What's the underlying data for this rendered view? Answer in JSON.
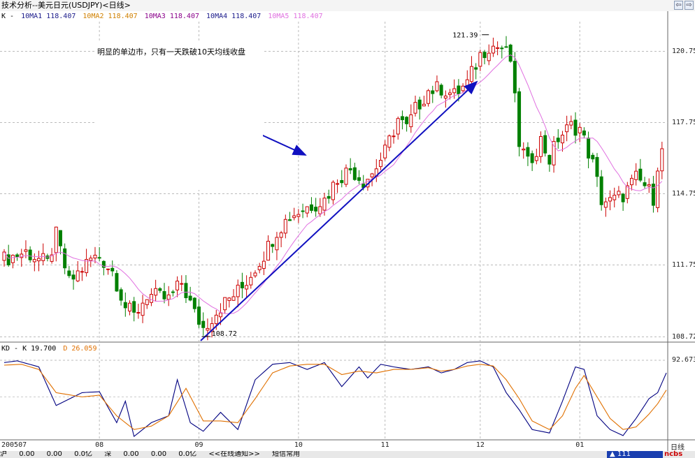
{
  "window": {
    "title": "技术分析--美元日元(USDJPY)<日线>",
    "buttons": [
      "⇦",
      "⇨"
    ]
  },
  "ma_legend": [
    {
      "text": "K -",
      "color": "#000000"
    },
    {
      "text": "10MA1  118.407",
      "color": "#1a1a8a"
    },
    {
      "text": "10MA2  118.407",
      "color": "#d08000"
    },
    {
      "text": "10MA3  118.407",
      "color": "#8a008a"
    },
    {
      "text": "10MA4  118.407",
      "color": "#1a1a8a"
    },
    {
      "text": "10MA5  118.407",
      "color": "#e070e0"
    }
  ],
  "annotation": "明显的单边市，只有一天跌破10天均线收盘",
  "kd_legend": [
    {
      "text": "KD - K 19.700",
      "color": "#000000"
    },
    {
      "text": "D 26.059",
      "color": "#e07000"
    }
  ],
  "status_bar": {
    "items": [
      "沪",
      "0.00",
      "0.00",
      "0.0亿",
      "深",
      "0.00",
      "0.00",
      "0.0亿",
      "<<在线通知>>",
      "短信常用"
    ],
    "badge": "▲ 111",
    "logo": "ncbs"
  },
  "chart_data": [
    {
      "type": "candlestick",
      "title": "",
      "ylim": [
        108.5,
        122.0
      ],
      "y_ticks": [
        "120.75",
        "117.75",
        "114.75",
        "111.75",
        "108.72"
      ],
      "y_tick_values": [
        120.75,
        117.75,
        114.75,
        111.75,
        108.72
      ],
      "x_ticks": [
        "200507",
        "08",
        "09",
        "10",
        "11",
        "12",
        "01"
      ],
      "x_tick_index": [
        0,
        22,
        45,
        68,
        88,
        110,
        133
      ],
      "x_axis_right_label": "日线",
      "n_periods": 153,
      "annotations": {
        "high": "121.39",
        "low": "108.72",
        "high_index": 112,
        "low_index": 46
      },
      "up_color": "#cc0000",
      "down_color": "#008000",
      "ma_color": "#e070e0",
      "anchors": [
        [
          0,
          112.0
        ],
        [
          5,
          112.3
        ],
        [
          10,
          111.8
        ],
        [
          12,
          113.0
        ],
        [
          15,
          111.0
        ],
        [
          20,
          112.0
        ],
        [
          22,
          112.1
        ],
        [
          25,
          111.5
        ],
        [
          28,
          110.0
        ],
        [
          30,
          109.6
        ],
        [
          33,
          110.5
        ],
        [
          38,
          110.3
        ],
        [
          41,
          111.0
        ],
        [
          44,
          109.7
        ],
        [
          46,
          109.1
        ],
        [
          50,
          110.0
        ],
        [
          55,
          110.8
        ],
        [
          60,
          112.2
        ],
        [
          63,
          113.2
        ],
        [
          66,
          113.8
        ],
        [
          70,
          114.2
        ],
        [
          74,
          114.5
        ],
        [
          77,
          115.4
        ],
        [
          80,
          115.8
        ],
        [
          83,
          115.3
        ],
        [
          85,
          115.6
        ],
        [
          88,
          116.5
        ],
        [
          91,
          117.9
        ],
        [
          93,
          117.5
        ],
        [
          95,
          118.3
        ],
        [
          98,
          119.1
        ],
        [
          101,
          119.2
        ],
        [
          104,
          118.9
        ],
        [
          107,
          119.4
        ],
        [
          110,
          120.6
        ],
        [
          112,
          121.0
        ],
        [
          115,
          120.9
        ],
        [
          117,
          120.4
        ],
        [
          119,
          116.9
        ],
        [
          121,
          116.0
        ],
        [
          124,
          117.0
        ],
        [
          126,
          116.2
        ],
        [
          128,
          117.1
        ],
        [
          131,
          117.6
        ],
        [
          133,
          117.5
        ],
        [
          136,
          116.0
        ],
        [
          138,
          114.5
        ],
        [
          140,
          114.4
        ],
        [
          143,
          114.7
        ],
        [
          146,
          115.4
        ],
        [
          148,
          115.1
        ],
        [
          150,
          114.6
        ],
        [
          151,
          116.0
        ],
        [
          153,
          117.0
        ]
      ]
    },
    {
      "type": "line",
      "title": "KD",
      "ylim": [
        0,
        100
      ],
      "y_ticks": [
        "92.673"
      ],
      "y_tick_values": [
        92.673
      ],
      "series": [
        {
          "name": "K",
          "color": "#000080",
          "anchors": [
            [
              0,
              90
            ],
            [
              3,
              92
            ],
            [
              8,
              85
            ],
            [
              12,
              40
            ],
            [
              18,
              55
            ],
            [
              22,
              56
            ],
            [
              26,
              20
            ],
            [
              28,
              45
            ],
            [
              30,
              4
            ],
            [
              34,
              20
            ],
            [
              38,
              28
            ],
            [
              40,
              70
            ],
            [
              43,
              20
            ],
            [
              46,
              10
            ],
            [
              50,
              32
            ],
            [
              54,
              12
            ],
            [
              58,
              70
            ],
            [
              62,
              88
            ],
            [
              66,
              90
            ],
            [
              70,
              82
            ],
            [
              74,
              90
            ],
            [
              78,
              62
            ],
            [
              82,
              85
            ],
            [
              84,
              72
            ],
            [
              87,
              88
            ],
            [
              90,
              85
            ],
            [
              94,
              82
            ],
            [
              98,
              85
            ],
            [
              101,
              78
            ],
            [
              104,
              82
            ],
            [
              107,
              90
            ],
            [
              110,
              92
            ],
            [
              113,
              85
            ],
            [
              116,
              55
            ],
            [
              119,
              35
            ],
            [
              122,
              12
            ],
            [
              126,
              8
            ],
            [
              129,
              45
            ],
            [
              132,
              85
            ],
            [
              134,
              82
            ],
            [
              137,
              28
            ],
            [
              140,
              12
            ],
            [
              143,
              5
            ],
            [
              146,
              25
            ],
            [
              149,
              48
            ],
            [
              151,
              55
            ],
            [
              153,
              78
            ]
          ]
        },
        {
          "name": "D",
          "color": "#e07000",
          "anchors": [
            [
              0,
              87
            ],
            [
              4,
              88
            ],
            [
              8,
              82
            ],
            [
              12,
              55
            ],
            [
              18,
              50
            ],
            [
              22,
              52
            ],
            [
              26,
              28
            ],
            [
              30,
              12
            ],
            [
              34,
              16
            ],
            [
              38,
              28
            ],
            [
              42,
              60
            ],
            [
              46,
              22
            ],
            [
              50,
              22
            ],
            [
              54,
              20
            ],
            [
              58,
              48
            ],
            [
              62,
              78
            ],
            [
              66,
              86
            ],
            [
              70,
              88
            ],
            [
              74,
              88
            ],
            [
              78,
              76
            ],
            [
              82,
              80
            ],
            [
              86,
              78
            ],
            [
              90,
              82
            ],
            [
              94,
              82
            ],
            [
              98,
              84
            ],
            [
              101,
              80
            ],
            [
              104,
              82
            ],
            [
              107,
              86
            ],
            [
              110,
              88
            ],
            [
              113,
              86
            ],
            [
              116,
              70
            ],
            [
              119,
              48
            ],
            [
              122,
              22
            ],
            [
              126,
              12
            ],
            [
              129,
              28
            ],
            [
              132,
              60
            ],
            [
              134,
              75
            ],
            [
              137,
              50
            ],
            [
              140,
              25
            ],
            [
              143,
              12
            ],
            [
              146,
              15
            ],
            [
              149,
              30
            ],
            [
              151,
              42
            ],
            [
              153,
              58
            ]
          ]
        }
      ]
    }
  ]
}
